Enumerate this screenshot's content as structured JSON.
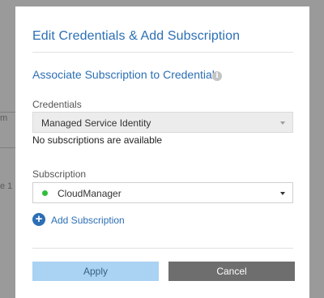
{
  "background": {
    "fragments": [
      "m",
      "e 1"
    ]
  },
  "dialog": {
    "title": "Edit Credentials & Add Subscription",
    "section_title": "Associate Subscription to Credentials",
    "info_icon": "info-icon",
    "credentials": {
      "label": "Credentials",
      "selected": "Managed Service Identity",
      "disabled": true
    },
    "credentials_note": "No subscriptions are available",
    "subscription": {
      "label": "Subscription",
      "selected": "CloudManager",
      "status_color": "#2fbf3a"
    },
    "add_subscription": {
      "icon": "plus-circle-icon",
      "label": "Add Subscription"
    },
    "buttons": {
      "apply": "Apply",
      "cancel": "Cancel"
    }
  },
  "colors": {
    "accent": "#2c6fb4",
    "apply_bg": "#a9d2f3",
    "cancel_bg": "#6e6e6e",
    "overlay": "#9a9a9a"
  }
}
